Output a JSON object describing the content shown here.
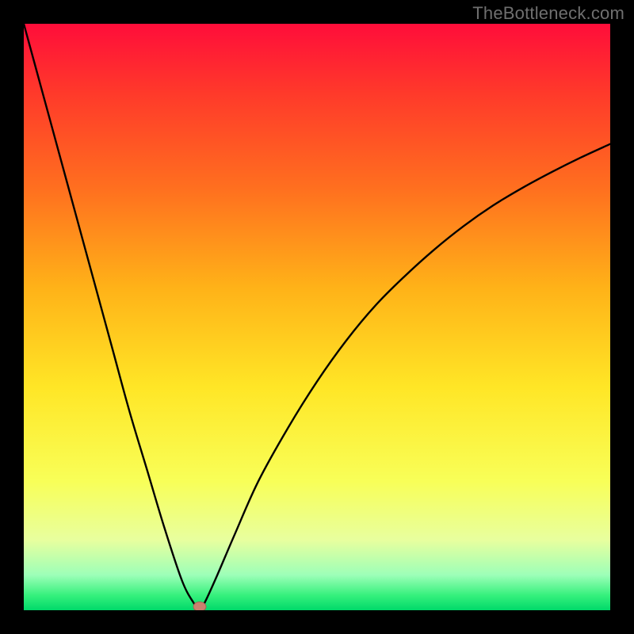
{
  "watermark": "TheBottleneck.com",
  "colors": {
    "frame": "#000000",
    "curve": "#000000",
    "marker_fill": "#c9816f",
    "marker_stroke": "#a86353",
    "gradient_stops": [
      {
        "offset": 0.0,
        "color": "#ff0d3a"
      },
      {
        "offset": 0.12,
        "color": "#ff3a2a"
      },
      {
        "offset": 0.28,
        "color": "#ff6f1f"
      },
      {
        "offset": 0.45,
        "color": "#ffb218"
      },
      {
        "offset": 0.62,
        "color": "#ffe626"
      },
      {
        "offset": 0.78,
        "color": "#f8ff58"
      },
      {
        "offset": 0.88,
        "color": "#e8ff9e"
      },
      {
        "offset": 0.94,
        "color": "#9dffb8"
      },
      {
        "offset": 0.975,
        "color": "#35f07c"
      },
      {
        "offset": 1.0,
        "color": "#00d96a"
      }
    ]
  },
  "chart_data": {
    "type": "line",
    "title": "",
    "xlabel": "",
    "ylabel": "",
    "xlim": [
      0,
      100
    ],
    "ylim": [
      0,
      100
    ],
    "x": [
      0,
      3,
      6,
      9,
      12,
      15,
      18,
      21,
      24,
      27,
      29,
      30,
      31,
      33,
      36,
      40,
      45,
      50,
      55,
      60,
      65,
      70,
      75,
      80,
      85,
      90,
      95,
      100
    ],
    "values": [
      100,
      89,
      78,
      67,
      56,
      45,
      34,
      24,
      14,
      5,
      1.2,
      0,
      1.6,
      6,
      13,
      22,
      31,
      39,
      46,
      52,
      57,
      61.5,
      65.5,
      69,
      72,
      74.7,
      77.2,
      79.5
    ],
    "marker": {
      "x": 30,
      "y": 0.6
    }
  }
}
